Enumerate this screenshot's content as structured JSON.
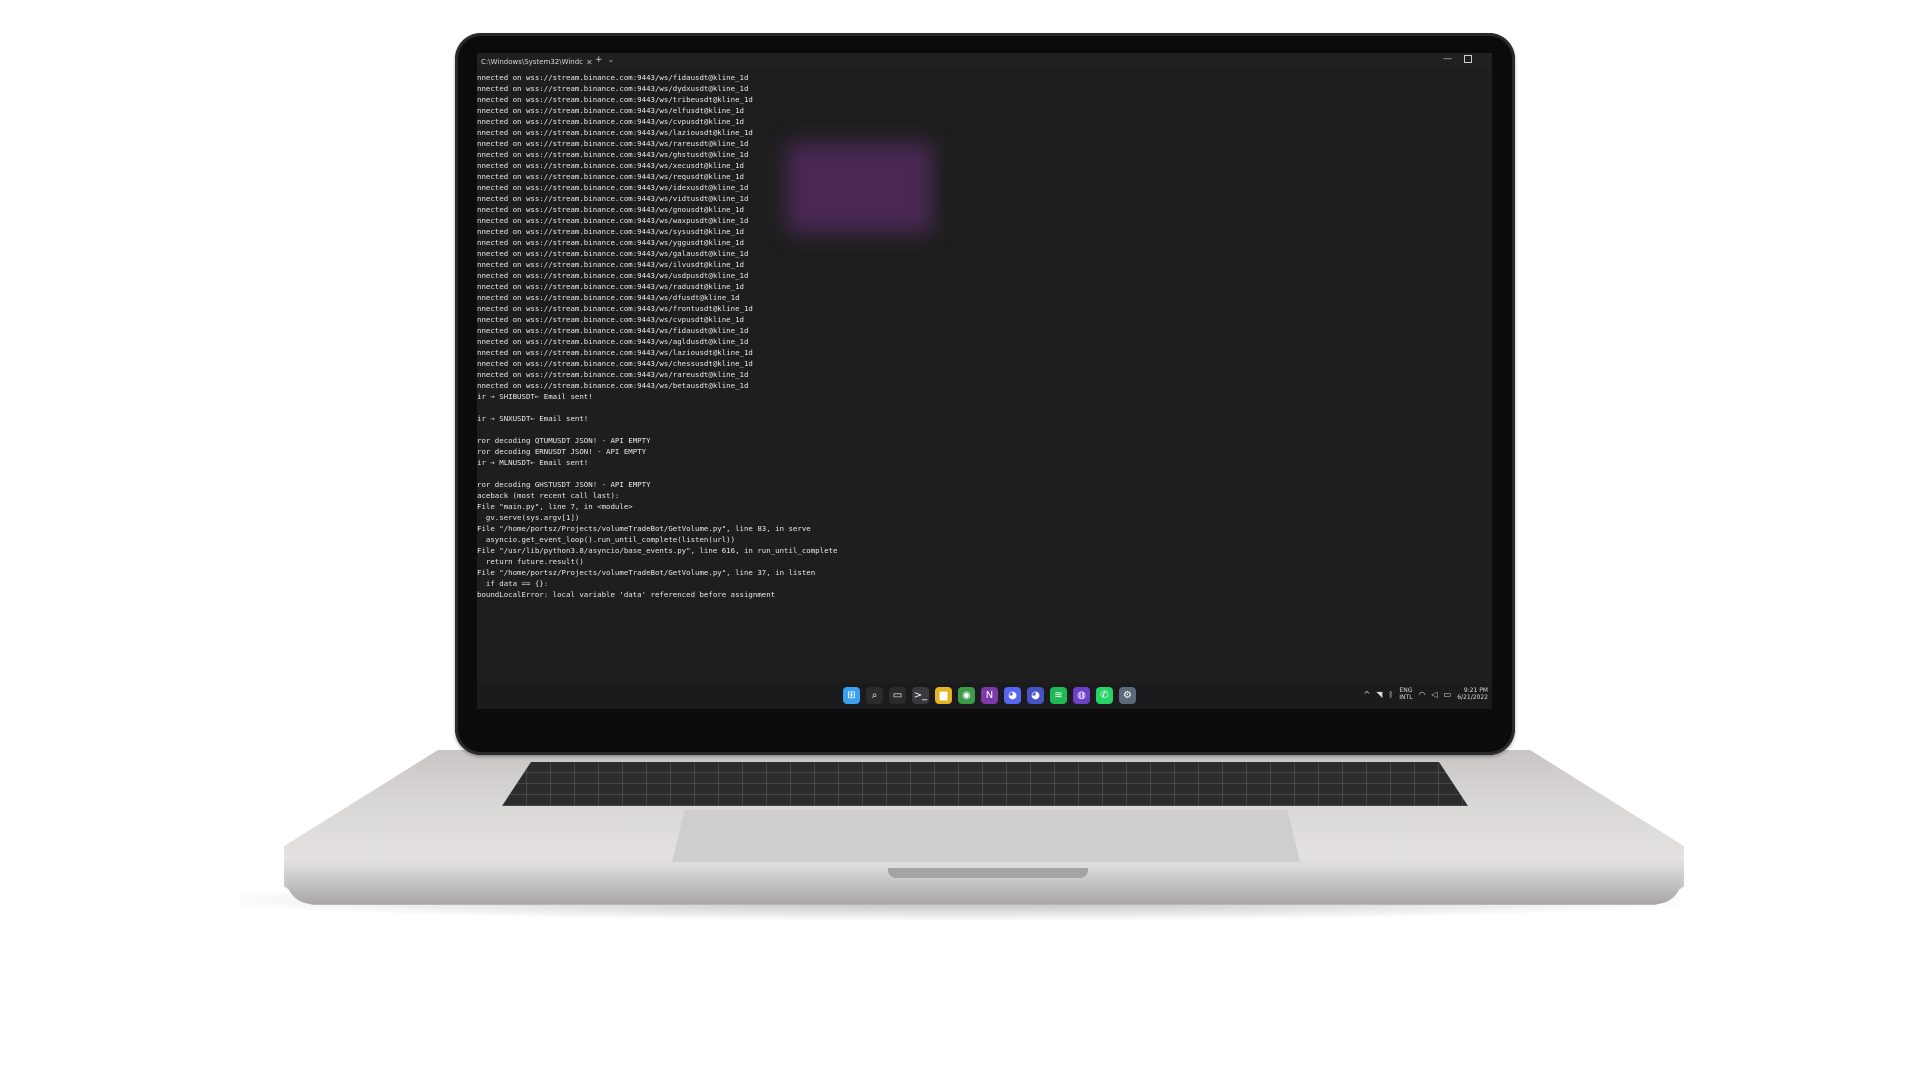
{
  "window": {
    "tab_title": "C:\\Windows\\System32\\Windc",
    "tab_close": "✕",
    "new_tab": "+",
    "dropdown": "⌄",
    "minimize": "—"
  },
  "console_lines": [
    "nnected on wss://stream.binance.com:9443/ws/fidausdt@kline_1d",
    "nnected on wss://stream.binance.com:9443/ws/dydxusdt@kline_1d",
    "nnected on wss://stream.binance.com:9443/ws/tribeusdt@kline_1d",
    "nnected on wss://stream.binance.com:9443/ws/elfusdt@kline_1d",
    "nnected on wss://stream.binance.com:9443/ws/cvpusdt@kline_1d",
    "nnected on wss://stream.binance.com:9443/ws/laziousdt@kline_1d",
    "nnected on wss://stream.binance.com:9443/ws/rareusdt@kline_1d",
    "nnected on wss://stream.binance.com:9443/ws/ghstusdt@kline_1d",
    "nnected on wss://stream.binance.com:9443/ws/xecusdt@kline_1d",
    "nnected on wss://stream.binance.com:9443/ws/requsdt@kline_1d",
    "nnected on wss://stream.binance.com:9443/ws/idexusdt@kline_1d",
    "nnected on wss://stream.binance.com:9443/ws/vidtusdt@kline_1d",
    "nnected on wss://stream.binance.com:9443/ws/gnousdt@kline_1d",
    "nnected on wss://stream.binance.com:9443/ws/waxpusdt@kline_1d",
    "nnected on wss://stream.binance.com:9443/ws/sysusdt@kline_1d",
    "nnected on wss://stream.binance.com:9443/ws/yggusdt@kline_1d",
    "nnected on wss://stream.binance.com:9443/ws/galausdt@kline_1d",
    "nnected on wss://stream.binance.com:9443/ws/ilvusdt@kline_1d",
    "nnected on wss://stream.binance.com:9443/ws/usdpusdt@kline_1d",
    "nnected on wss://stream.binance.com:9443/ws/radusdt@kline_1d",
    "nnected on wss://stream.binance.com:9443/ws/dfusdt@kline_1d",
    "nnected on wss://stream.binance.com:9443/ws/frontusdt@kline_1d",
    "nnected on wss://stream.binance.com:9443/ws/cvpusdt@kline_1d",
    "nnected on wss://stream.binance.com:9443/ws/fidausdt@kline_1d",
    "nnected on wss://stream.binance.com:9443/ws/agldusdt@kline_1d",
    "nnected on wss://stream.binance.com:9443/ws/laziousdt@kline_1d",
    "nnected on wss://stream.binance.com:9443/ws/chessusdt@kline_1d",
    "nnected on wss://stream.binance.com:9443/ws/rareusdt@kline_1d",
    "nnected on wss://stream.binance.com:9443/ws/betausdt@kline_1d",
    "ir → SHIBUSDT← Email sent!",
    "",
    "ir → SNXUSDT← Email sent!",
    "",
    "ror decoding QTUMUSDT JSON! - API EMPTY",
    "ror decoding ERNUSDT JSON! - API EMPTY",
    "ir → MLNUSDT← Email sent!",
    "",
    "ror decoding GHSTUSDT JSON! - API EMPTY",
    "aceback (most recent call last):",
    "File \"main.py\", line 7, in <module>",
    "  gv.serve(sys.argv[1])",
    "File \"/home/portsz/Projects/volumeTradeBot/GetVolume.py\", line 83, in serve",
    "  asyncio.get_event_loop().run_until_complete(listen(url))",
    "File \"/usr/lib/python3.8/asyncio/base_events.py\", line 616, in run_until_complete",
    "  return future.result()",
    "File \"/home/portsz/Projects/volumeTradeBot/GetVolume.py\", line 37, in listen",
    "  if data == {}:",
    "boundLocalError: local variable 'data' referenced before assignment"
  ],
  "taskbar": {
    "icons": [
      {
        "name": "start-icon",
        "glyph": "⊞",
        "color": "#3aa0f0"
      },
      {
        "name": "search-icon",
        "glyph": "⌕",
        "color": "#2b2b2e"
      },
      {
        "name": "task-view-icon",
        "glyph": "▭",
        "color": "#2b2b2e"
      },
      {
        "name": "terminal-icon",
        "glyph": ">_",
        "color": "#3a3a3e"
      },
      {
        "name": "file-explorer-icon",
        "glyph": "▆",
        "color": "#e6b422"
      },
      {
        "name": "chrome-icon",
        "glyph": "◉",
        "color": "#3c9b4a"
      },
      {
        "name": "onenote-icon",
        "glyph": "N",
        "color": "#7b3aa8"
      },
      {
        "name": "discord-icon",
        "glyph": "◕",
        "color": "#5865f2"
      },
      {
        "name": "discord-alt-icon",
        "glyph": "◕",
        "color": "#4752c4"
      },
      {
        "name": "spotify-icon",
        "glyph": "≋",
        "color": "#1db954"
      },
      {
        "name": "github-icon",
        "glyph": "◍",
        "color": "#6e40c9"
      },
      {
        "name": "whatsapp-icon",
        "glyph": "✆",
        "color": "#25d366"
      },
      {
        "name": "settings-icon",
        "glyph": "⚙",
        "color": "#5a6a7a"
      }
    ],
    "tray": {
      "chevron": "^",
      "lang_top": "ENG",
      "lang_bottom": "INTL",
      "time": "9:21 PM",
      "date": "6/21/2022"
    }
  }
}
